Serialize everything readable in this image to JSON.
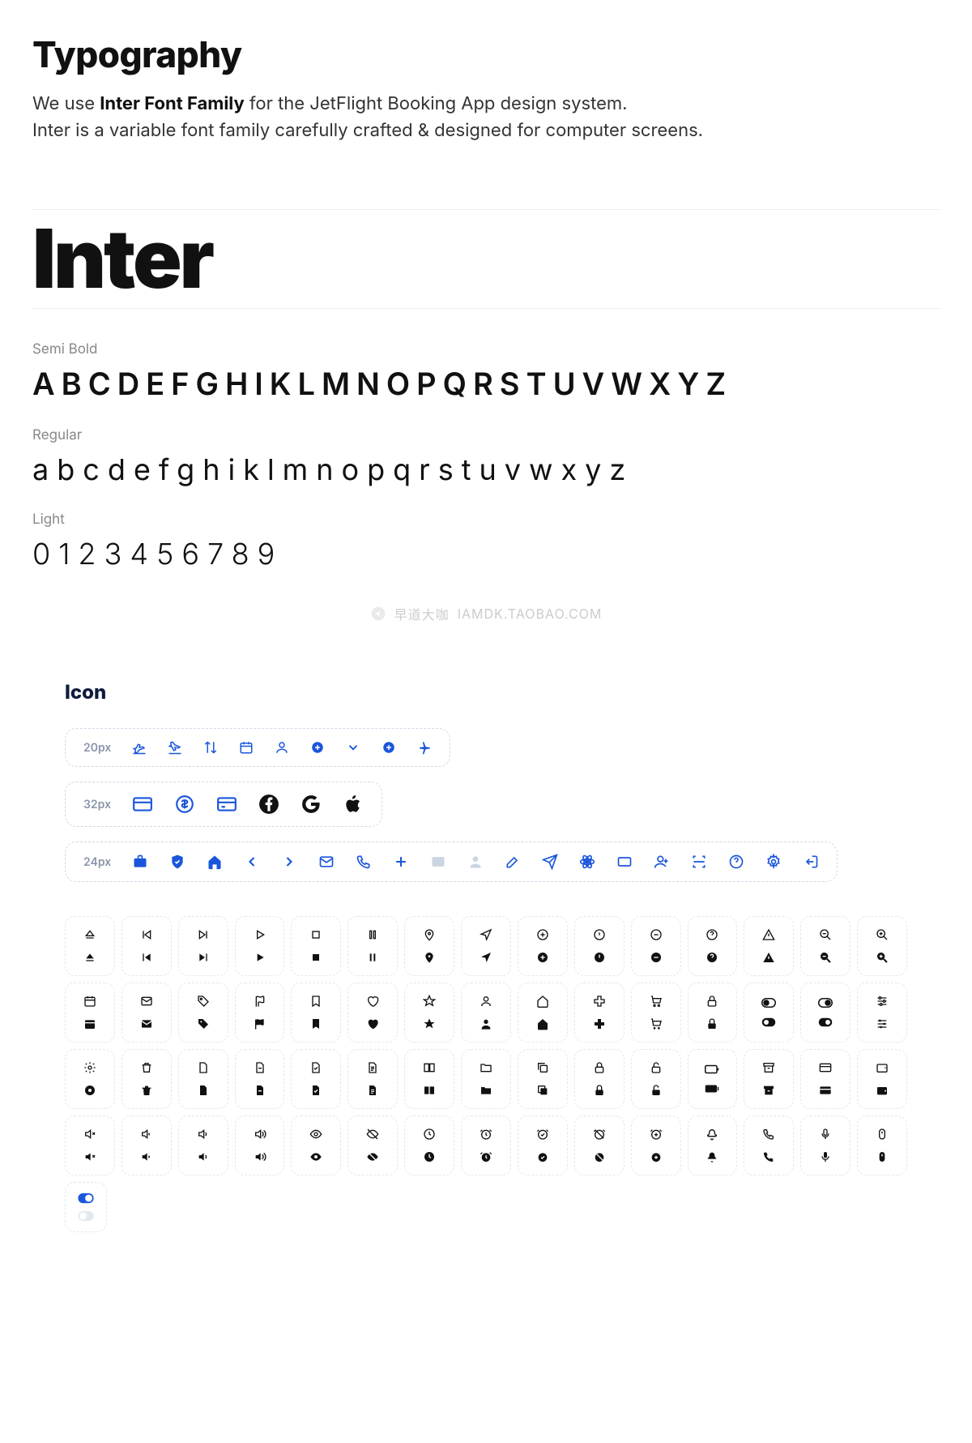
{
  "title": "Typography",
  "subtitle_prefix": "We use ",
  "subtitle_bold": "Inter Font Family",
  "subtitle_suffix": " for the JetFlight Booking App design system.",
  "subtitle_line2": "Inter is a variable font family carefully crafted & designed for computer screens.",
  "brandFont": "Inter",
  "weights": {
    "semibold": {
      "label": "Semi Bold",
      "sample": "ABCDEFGHIKLMNOPQRSTUVWXYZ"
    },
    "regular": {
      "label": "Regular",
      "sample": "abcdefghiklmnopqrstuvwxyz"
    },
    "light": {
      "label": "Light",
      "sample": "0123456789"
    }
  },
  "watermark": {
    "chinese": "早道大咖",
    "url": "IAMDK.TAOBAO.COM"
  },
  "iconSection": {
    "title": "Icon",
    "row20": "20px",
    "row32": "32px",
    "row24": "24px"
  }
}
